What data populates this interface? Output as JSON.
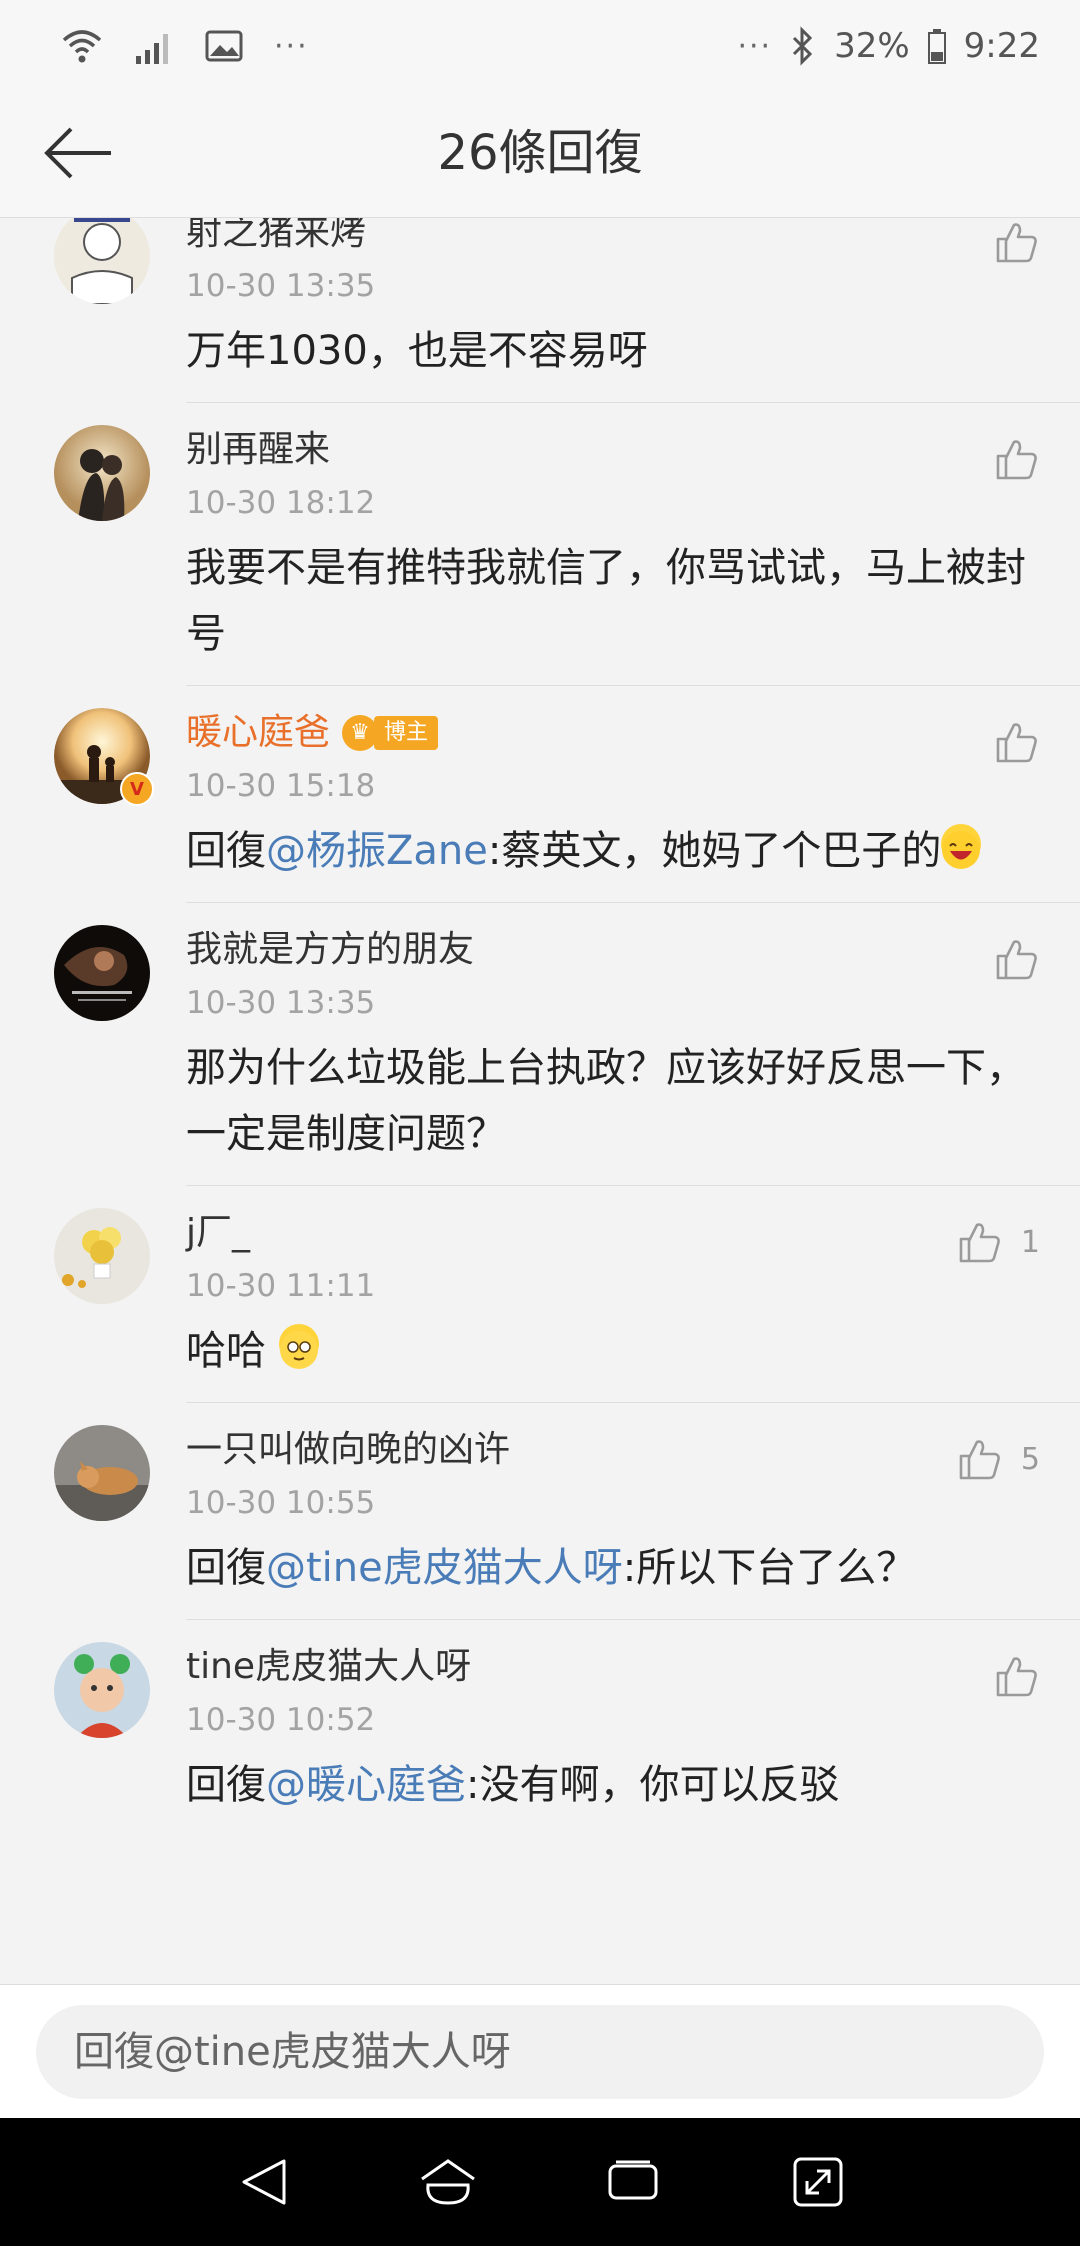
{
  "status_bar": {
    "battery": "32%",
    "time": "9:22",
    "left_dots": "···",
    "right_dots": "···"
  },
  "header": {
    "title": "26條回復"
  },
  "comments": [
    {
      "name": "射之猪来烤",
      "time": "10-30 13:35",
      "text": "万年1030，也是不容易呀",
      "likes": ""
    },
    {
      "name": "别再醒来",
      "time": "10-30 18:12",
      "text": "我要不是有推特我就信了，你骂试试，马上被封号",
      "likes": ""
    },
    {
      "name": "暖心庭爸",
      "badge": "博主",
      "time": "10-30 15:18",
      "reply_prefix": "回復",
      "mention": "@杨振Zane",
      "text": ":蔡英文，她妈了个巴子的",
      "likes": ""
    },
    {
      "name": "我就是方方的朋友",
      "time": "10-30 13:35",
      "text": "那为什么垃圾能上台执政？应该好好反思一下，一定是制度问题？",
      "likes": ""
    },
    {
      "name": "j厂_",
      "time": "10-30 11:11",
      "text": "哈哈",
      "likes": "1"
    },
    {
      "name": "一只叫做向晚的凶许",
      "time": "10-30 10:55",
      "reply_prefix": "回復",
      "mention": "@tine虎皮猫大人呀",
      "text": ":所以下台了么？",
      "likes": "5"
    },
    {
      "name": "tine虎皮猫大人呀",
      "time": "10-30 10:52",
      "reply_prefix": "回復",
      "mention": "@暖心庭爸",
      "text": ":没有啊，你可以反驳",
      "likes": ""
    }
  ],
  "reply_bar": {
    "placeholder": "回復@tine虎皮猫大人呀"
  },
  "colors": {
    "accent_link": "#4a7cb7",
    "owner_name": "#e8702a",
    "badge": "#f5a623"
  }
}
